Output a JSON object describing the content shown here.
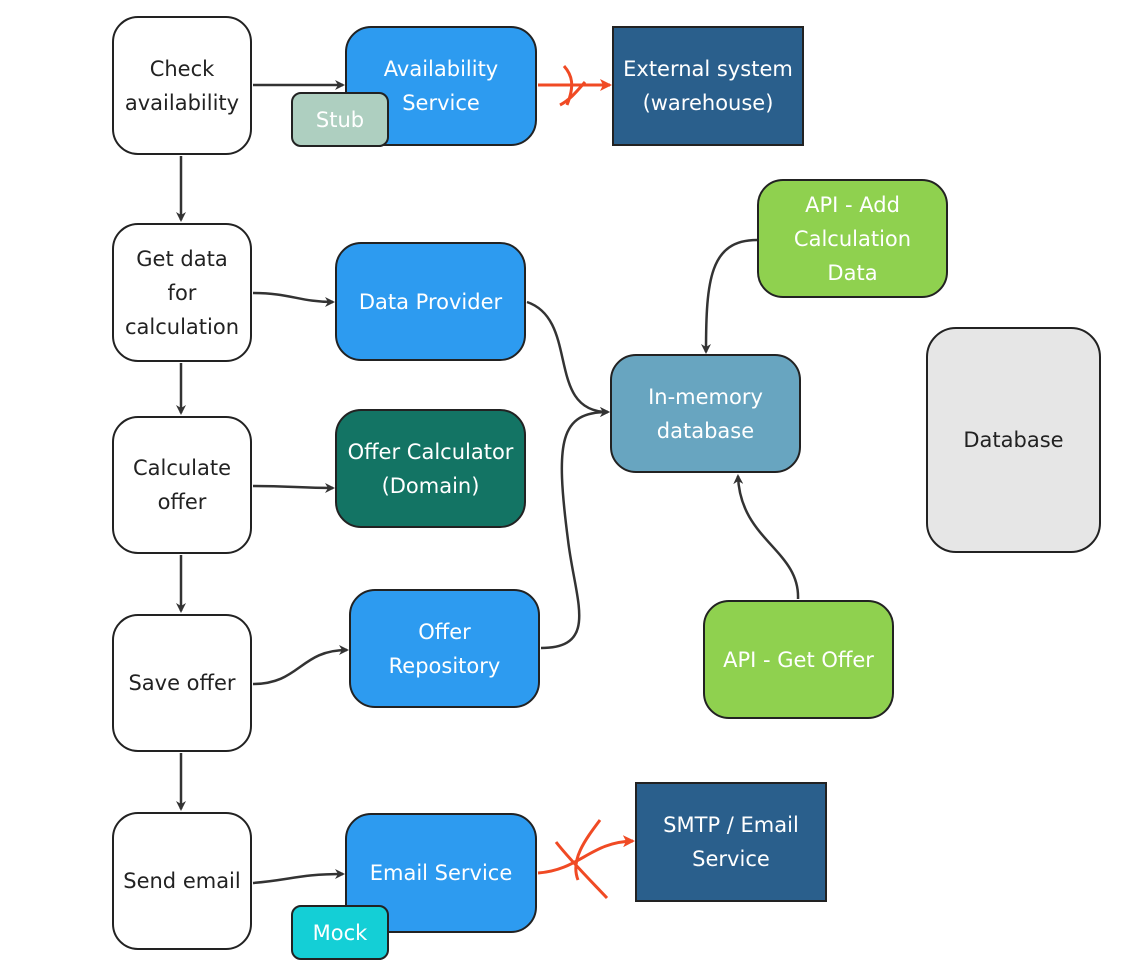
{
  "steps": {
    "check": "Check\navailability",
    "getdata": "Get data\nfor\ncalculation",
    "calc": "Calculate\noffer",
    "save": "Save offer",
    "send": "Send email"
  },
  "components": {
    "availability": "Availability\nService",
    "stub": "Stub",
    "external": "External system\n(warehouse)",
    "data_provider": "Data Provider",
    "offer_calculator": "Offer Calculator\n(Domain)",
    "offer_repository": "Offer\nRepository",
    "email_service": "Email Service",
    "mock": "Mock",
    "smtp": "SMTP / Email\nService",
    "in_memory_db": "In-memory\ndatabase",
    "api_add": "API - Add\nCalculation\nData",
    "api_get": "API - Get Offer",
    "database": "Database"
  },
  "colors": {
    "service": "#2d9bf0",
    "external": "#2a5f8c",
    "domain": "#137464",
    "stub": "#aecfc0",
    "mock": "#14cfd6",
    "api": "#8fd14f",
    "in_memory": "#68a5c0",
    "database": "#e6e6e6",
    "blocked_edge": "#f04a24"
  }
}
